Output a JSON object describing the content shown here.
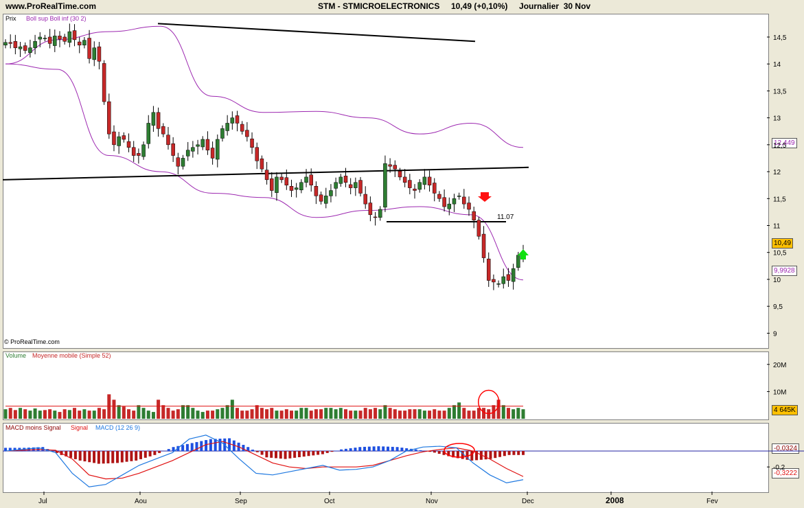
{
  "header": {
    "site": "www.ProRealTime.com",
    "info": "STM - STMICROELECTRONICS     10,49 (+0,10%)     Journalier  30 Nov"
  },
  "price_panel": {
    "title": "Prix",
    "legend": "Boll sup Boll inf (30 2)",
    "copyright": "© ProRealTime.com",
    "support_label": "11.07",
    "last_tag": "10,49",
    "upper_tag": "12,449",
    "lower_tag": "9,9928"
  },
  "volume_panel": {
    "legend_volume": "Volume",
    "legend_ma": "Moyenne mobile (Simple 52)",
    "last_tag": "4 645K"
  },
  "macd_panel": {
    "legend_hist": "MACD moins Signal",
    "legend_signal": "Signal",
    "legend_macd": "MACD (12 26 9)",
    "hist_tag": "-0,0324",
    "macd_tag": "-0,3222"
  },
  "colors": {
    "up": "#2e7d32",
    "down": "#c62828",
    "boll": "#9c27b0",
    "macd": "#1e78e0",
    "signal": "#e01010",
    "hist_up": "#1e50e0",
    "hist_down": "#b01414"
  },
  "chart_data": [
    {
      "type": "candlestick",
      "title": "Prix",
      "y_ticks": [
        "14,5",
        "14",
        "13,5",
        "13",
        "12,5",
        "12",
        "11,5",
        "11",
        "10,5",
        "10",
        "9,5",
        "9"
      ],
      "ylim": [
        8.75,
        14.78
      ],
      "x_ticks": [
        "Jul",
        "Aou",
        "Sep",
        "Oct",
        "Nov",
        "Dec",
        "2008",
        "Fev"
      ],
      "close": [
        14.4,
        14.38,
        14.3,
        14.32,
        14.25,
        14.3,
        14.42,
        14.5,
        14.48,
        14.38,
        14.52,
        14.46,
        14.42,
        14.6,
        14.45,
        14.35,
        14.44,
        14.1,
        14.3,
        14.05,
        13.3,
        12.7,
        12.5,
        12.65,
        12.6,
        12.45,
        12.3,
        12.3,
        12.5,
        12.9,
        13.1,
        12.8,
        12.7,
        12.5,
        12.3,
        12.1,
        12.25,
        12.4,
        12.45,
        12.5,
        12.6,
        12.4,
        12.25,
        12.6,
        12.8,
        12.9,
        13.0,
        12.9,
        12.75,
        12.65,
        12.45,
        12.2,
        12.05,
        11.85,
        11.65,
        11.9,
        11.85,
        11.75,
        11.65,
        11.7,
        11.8,
        11.9,
        11.75,
        11.55,
        11.45,
        11.55,
        11.65,
        11.8,
        11.9,
        11.8,
        11.7,
        11.8,
        11.6,
        11.4,
        11.2,
        11.15,
        11.3,
        12.15,
        12.1,
        12.05,
        11.9,
        11.8,
        11.7,
        11.65,
        11.8,
        11.9,
        11.75,
        11.6,
        11.5,
        11.35,
        11.4,
        11.5,
        11.55,
        11.4,
        11.3,
        11.1,
        10.8,
        10.4,
        9.98,
        9.95,
        9.92,
        10.05,
        9.98,
        10.2,
        10.45,
        10.49
      ],
      "upper_band": [
        14.0,
        14.45,
        14.6,
        14.7,
        13.4,
        13.1,
        13.12,
        13.0,
        12.7,
        12.9,
        12.45
      ],
      "lower_band": [
        14.0,
        13.9,
        12.3,
        12.0,
        11.6,
        11.52,
        11.15,
        11.28,
        11.35,
        11.2,
        9.99
      ],
      "trendlines": [
        {
          "from": [
            14.75
          ],
          "to": [
            14.42
          ]
        },
        {
          "from": [
            11.85
          ],
          "to": [
            12.08
          ]
        }
      ],
      "support": 11.07
    },
    {
      "type": "bar",
      "title": "Volume",
      "y_ticks": [
        "20M",
        "10M"
      ],
      "ylim": [
        0,
        24
      ],
      "volume": [
        3.5,
        4.0,
        3.2,
        4.0,
        3.5,
        3.0,
        3.8,
        3.0,
        3.2,
        3.5,
        3.0,
        2.5,
        3.5,
        3.2,
        4.0,
        3.0,
        3.5,
        3.0,
        3.0,
        4.0,
        3.5,
        9.0,
        7.0,
        5.0,
        4.5,
        3.5,
        3.0,
        5.0,
        4.0,
        3.0,
        2.5,
        7.0,
        5.0,
        4.0,
        3.0,
        3.5,
        5.0,
        5.0,
        4.0,
        3.0,
        2.5,
        3.0,
        3.0,
        3.5,
        4.0,
        5.0,
        7.0,
        4.0,
        3.0,
        3.0,
        3.5,
        5.0,
        4.0,
        3.5,
        4.0,
        3.0,
        3.0,
        3.5,
        3.0,
        3.0,
        4.0,
        4.0,
        3.0,
        3.5,
        3.5,
        4.0,
        4.0,
        3.5,
        4.0,
        3.5,
        3.0,
        3.0,
        3.0,
        4.0,
        3.5,
        4.0,
        3.5,
        5.0,
        4.0,
        3.5,
        3.0,
        3.0,
        3.5,
        3.5,
        3.5,
        3.0,
        3.0,
        3.5,
        3.0,
        3.0,
        4.0,
        5.0,
        6.0,
        4.0,
        3.0,
        3.0,
        4.0,
        4.0,
        3.5,
        5.0,
        7.0,
        5.0,
        4.0,
        3.5,
        4.0,
        3.5
      ],
      "moving_average": 4.645
    },
    {
      "type": "line",
      "title": "MACD (12 26 9)",
      "y_ticks": [
        "-0,2"
      ],
      "ylim": [
        -0.5,
        0.25
      ],
      "macd": [
        0.0,
        0.02,
        0.04,
        -0.02,
        -0.28,
        -0.45,
        -0.42,
        -0.3,
        -0.18,
        -0.1,
        -0.02,
        0.15,
        0.2,
        0.1,
        -0.1,
        -0.28,
        -0.3,
        -0.26,
        -0.22,
        -0.18,
        -0.24,
        -0.23,
        -0.2,
        -0.12,
        0.0,
        0.05,
        0.06,
        0.04,
        -0.15,
        -0.3,
        -0.4,
        -0.36
      ],
      "signal": [
        0.0,
        0.01,
        0.02,
        0.01,
        -0.1,
        -0.3,
        -0.35,
        -0.34,
        -0.28,
        -0.2,
        -0.12,
        -0.02,
        0.08,
        0.12,
        0.05,
        -0.05,
        -0.15,
        -0.2,
        -0.22,
        -0.2,
        -0.2,
        -0.2,
        -0.18,
        -0.12,
        -0.06,
        -0.01,
        0.02,
        0.04,
        0.0,
        -0.1,
        -0.22,
        -0.32
      ],
      "histogram": [
        0.04,
        0.04,
        0.05,
        -0.05,
        -0.12,
        -0.16,
        -0.15,
        -0.12,
        -0.05,
        0.05,
        0.1,
        0.15,
        0.16,
        0.05,
        -0.08,
        -0.1,
        -0.07,
        -0.04,
        0.02,
        0.05,
        0.06,
        0.05,
        0.02,
        -0.02,
        -0.08,
        -0.12,
        -0.1,
        -0.05
      ]
    }
  ]
}
